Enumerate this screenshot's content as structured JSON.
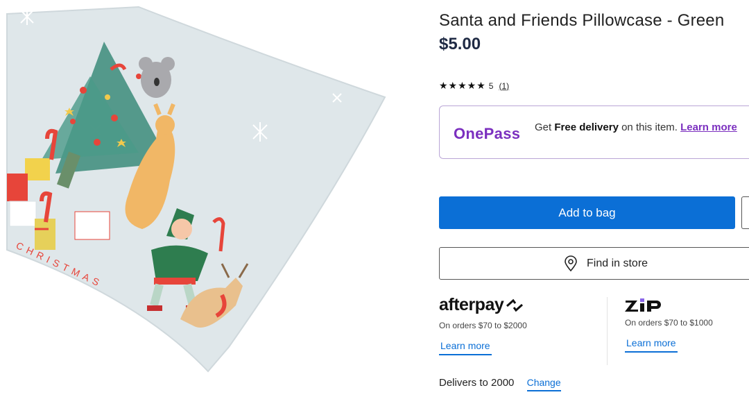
{
  "product": {
    "image_alt": "",
    "image_text": "CHRISTMAS",
    "title": "Santa and Friends Pillowcase - Green",
    "price": "$5.00",
    "rating": {
      "stars": "★★★★★",
      "value": "5",
      "count": "(1)"
    }
  },
  "onepass": {
    "logo": "OnePass",
    "text_prefix": "Get ",
    "text_bold": "Free delivery",
    "text_suffix": " on this item. ",
    "link": "Learn more",
    "accent": "#7b2fbf"
  },
  "actions": {
    "add_to_bag": "Add to bag",
    "find_in_store": "Find in store",
    "primary_color": "#0b6fd6"
  },
  "payments": {
    "afterpay": {
      "logo": "afterpay",
      "sub": "On orders $70 to $2000",
      "link": "Learn more"
    },
    "zip": {
      "logo": "zip",
      "sub": "On orders $70 to $1000",
      "link": "Learn more"
    }
  },
  "delivery": {
    "text": "Delivers to 2000",
    "link": "Change"
  }
}
